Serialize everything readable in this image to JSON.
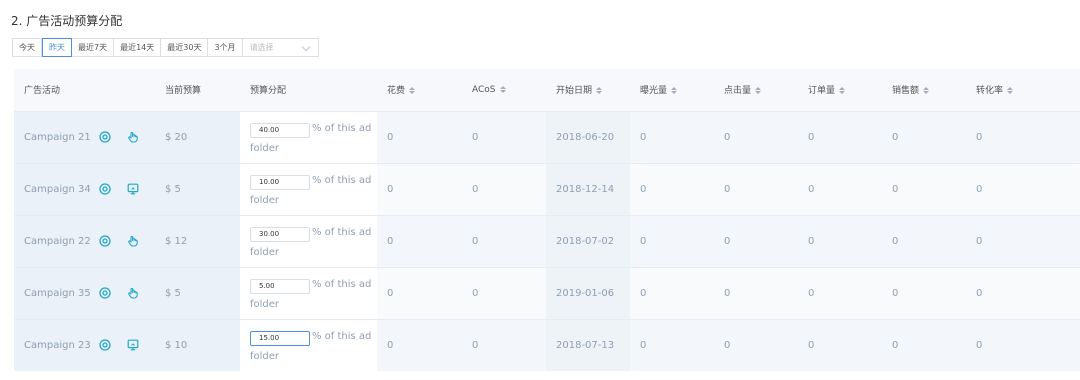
{
  "title": "2. 广告活动预算分配",
  "date_ranges": [
    "今天",
    "昨天",
    "最近7天",
    "最近14天",
    "最近30天",
    "3个月"
  ],
  "active_range": "昨天",
  "select_placeholder": "请选择",
  "columns": [
    "广告活动",
    "当前预算",
    "预算分配",
    "花费",
    "ACoS",
    "开始日期",
    "曝光量",
    "点击量",
    "订单量",
    "销售额",
    "转化率"
  ],
  "alloc_suffix": "% of this ad",
  "alloc_suffix2": "folder",
  "rows": [
    {
      "campaign": "Campaign 21",
      "icon2": "hand-icon",
      "budget": "$ 20",
      "alloc": "40.00",
      "spend": "0",
      "acos": "0",
      "start": "2018-06-20",
      "impressions": "0",
      "clicks": "0",
      "orders": "0",
      "sales": "0",
      "conversion": "0"
    },
    {
      "campaign": "Campaign 34",
      "icon2": "monitor-icon",
      "budget": "$ 5",
      "alloc": "10.00",
      "spend": "0",
      "acos": "0",
      "start": "2018-12-14",
      "impressions": "0",
      "clicks": "0",
      "orders": "0",
      "sales": "0",
      "conversion": "0"
    },
    {
      "campaign": "Campaign 22",
      "icon2": "hand-icon",
      "budget": "$ 12",
      "alloc": "30.00",
      "spend": "0",
      "acos": "0",
      "start": "2018-07-02",
      "impressions": "0",
      "clicks": "0",
      "orders": "0",
      "sales": "0",
      "conversion": "0"
    },
    {
      "campaign": "Campaign 35",
      "icon2": "hand-icon",
      "budget": "$ 5",
      "alloc": "5.00",
      "spend": "0",
      "acos": "0",
      "start": "2019-01-06",
      "impressions": "0",
      "clicks": "0",
      "orders": "0",
      "sales": "0",
      "conversion": "0"
    },
    {
      "campaign": "Campaign 23",
      "icon2": "monitor-icon",
      "budget": "$ 10",
      "alloc": "15.00",
      "spend": "0",
      "acos": "0",
      "start": "2018-07-13",
      "impressions": "0",
      "clicks": "0",
      "orders": "0",
      "sales": "0",
      "conversion": "0",
      "focused": true
    }
  ]
}
